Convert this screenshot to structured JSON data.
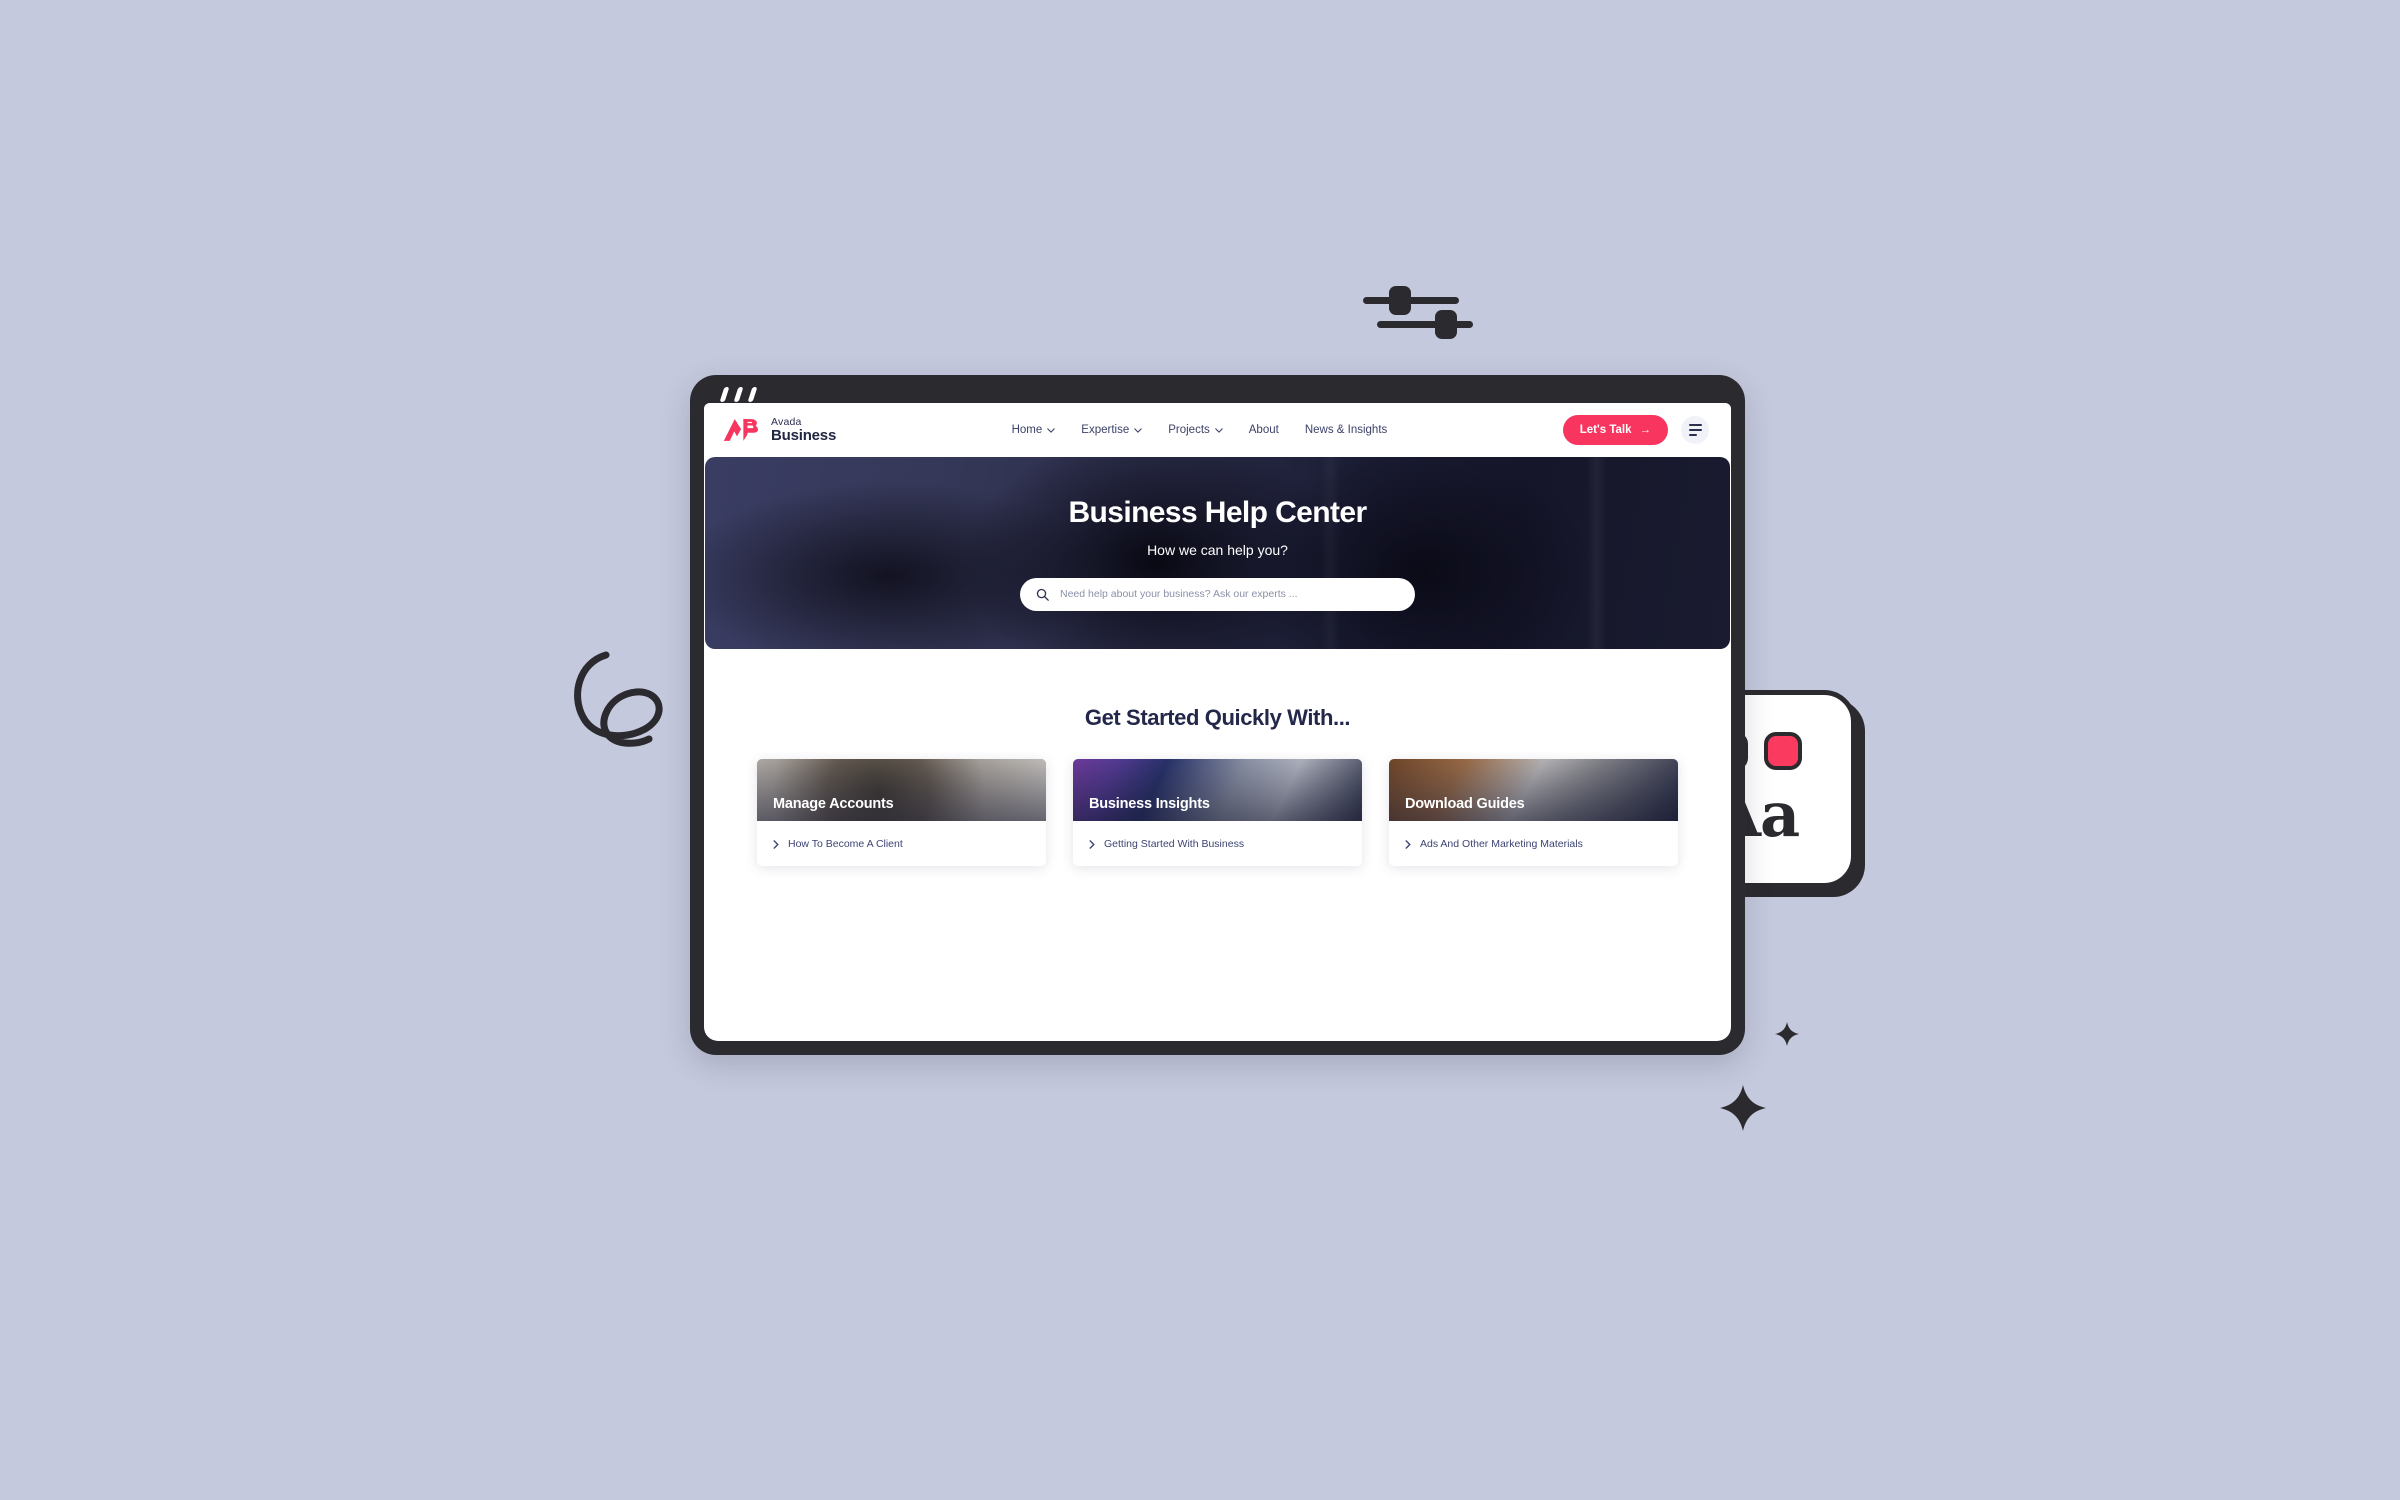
{
  "background_color": "#c5c9dd",
  "browser": {
    "frame_color": "#2b2a2e",
    "window_dots_count": 3
  },
  "site": {
    "logo": {
      "mark_text": "AB",
      "top_label": "Avada",
      "bottom_label": "Business",
      "brand_color": "#f7355f",
      "text_color": "#222743"
    },
    "nav": [
      {
        "label": "Home",
        "has_dropdown": true
      },
      {
        "label": "Expertise",
        "has_dropdown": true
      },
      {
        "label": "Projects",
        "has_dropdown": true
      },
      {
        "label": "About",
        "has_dropdown": false
      },
      {
        "label": "News & Insights",
        "has_dropdown": false
      }
    ],
    "cta": {
      "label": "Let's Talk",
      "arrow": "→",
      "color": "#f7355f"
    },
    "menu_icon": "hamburger-icon"
  },
  "hero": {
    "title": "Business Help Center",
    "subtitle": "How we can help you?",
    "search": {
      "placeholder": "Need help about your business? Ask our experts ...",
      "value": "",
      "icon": "search-icon"
    }
  },
  "get_started": {
    "heading": "Get Started Quickly With...",
    "cards": [
      {
        "title": "Manage Accounts",
        "link": "How To Become A Client"
      },
      {
        "title": "Business Insights",
        "link": "Getting Started With Business"
      },
      {
        "title": "Download Guides",
        "link": "Ads And Other Marketing Materials"
      }
    ]
  },
  "decorations": {
    "sliders_icon": "sliders-icon",
    "squiggle_icon": "squiggle-e-icon",
    "sparkle_big_icon": "sparkle-icon",
    "sparkle_small_icon": "sparkle-icon",
    "font_card": {
      "sample_text": "Aa",
      "swatch_1_color": "#d43c63",
      "swatch_2_color": "#fb3a60"
    }
  }
}
